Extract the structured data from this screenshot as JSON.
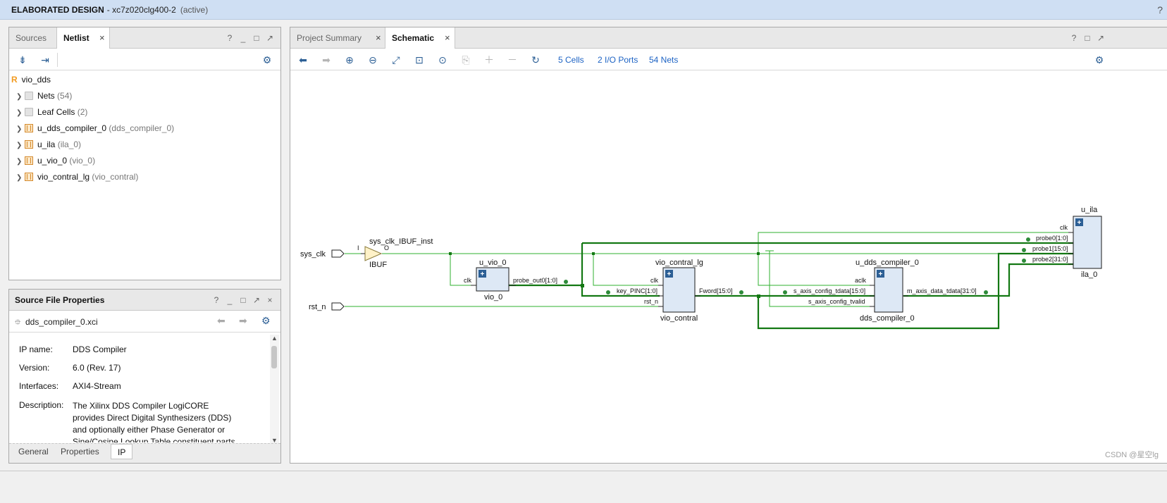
{
  "window": {
    "title": "ELABORATED DESIGN",
    "part": "- xc7z020clg400-2",
    "status": "(active)",
    "help": "?"
  },
  "netlist_panel": {
    "tabs": [
      {
        "label": "Sources"
      },
      {
        "label": "Netlist",
        "close": "×"
      }
    ],
    "controls": [
      "?",
      "_",
      "□",
      "↗"
    ],
    "root": {
      "badge": "R",
      "label": "vio_dds"
    },
    "items": [
      {
        "name": "Nets",
        "suffix": "(54)",
        "icon": "folder-icon"
      },
      {
        "name": "Leaf Cells",
        "suffix": "(2)",
        "icon": "folder-icon"
      },
      {
        "name": "u_dds_compiler_0",
        "suffix": "(dds_compiler_0)",
        "icon": "cell-icon"
      },
      {
        "name": "u_ila",
        "suffix": "(ila_0)",
        "icon": "cell-icon"
      },
      {
        "name": "u_vio_0",
        "suffix": "(vio_0)",
        "icon": "cell-icon"
      },
      {
        "name": "vio_contral_lg",
        "suffix": "(vio_contral)",
        "icon": "cell-icon"
      }
    ]
  },
  "properties_panel": {
    "title": "Source File Properties",
    "controls": [
      "?",
      "_",
      "□",
      "↗",
      "×"
    ],
    "file": "dds_compiler_0.xci",
    "props": [
      {
        "label": "IP name:",
        "value": "DDS Compiler"
      },
      {
        "label": "Version:",
        "value": "6.0 (Rev. 17)"
      },
      {
        "label": "Interfaces:",
        "value": "AXI4-Stream"
      }
    ],
    "description_label": "Description:",
    "description_lines": [
      "The Xilinx DDS Compiler LogiCORE",
      "provides Direct Digital Synthesizers (DDS)",
      "and optionally either Phase Generator or",
      "Sine/Cosine Lookup Table constituent parts"
    ],
    "bottom_tabs": [
      "General",
      "Properties",
      "IP"
    ],
    "active_bottom_tab": "IP"
  },
  "schematic_panel": {
    "tabs": [
      {
        "label": "Project Summary",
        "close": "×"
      },
      {
        "label": "Schematic",
        "close": "×"
      }
    ],
    "controls": [
      "?",
      "□",
      "↗"
    ],
    "summary_links": [
      "5 Cells",
      "2 I/O Ports",
      "54 Nets"
    ],
    "ports": {
      "sys_clk": "sys_clk",
      "rst_n": "rst_n"
    },
    "ibuf": {
      "inst": "sys_clk_IBUF_inst",
      "type": "IBUF",
      "in_pin": "I",
      "out_pin": "O"
    },
    "vio": {
      "inst": "u_vio_0",
      "type": "vio_0",
      "in_pin": "clk",
      "out_pin": "probe_out0[1:0]"
    },
    "contral": {
      "inst": "vio_contral_lg",
      "type": "vio_contral",
      "pins_in": [
        "clk",
        "key_PINC[1:0]",
        "rst_n"
      ],
      "out_pin": "Fword[15:0]"
    },
    "dds": {
      "inst": "u_dds_compiler_0",
      "type": "dds_compiler_0",
      "pins_in": [
        "aclk",
        "s_axis_config_tdata[15:0]",
        "s_axis_config_tvalid"
      ],
      "out_pin": "m_axis_data_tdata[31:0]"
    },
    "ila": {
      "inst": "u_ila",
      "type": "ila_0",
      "pins_in": [
        "clk",
        "probe0[1:0]",
        "probe1[15:0]",
        "probe2[31:0]"
      ]
    },
    "plus": "+"
  },
  "watermark": "CSDN @星空lg",
  "colors": {
    "wire": "#2fb12f",
    "bus": "#137813",
    "cell_fill": "#dde8f5",
    "cell_border": "#1a1a1a",
    "link": "#1d63c4",
    "titlebar": "#cfdff3"
  }
}
